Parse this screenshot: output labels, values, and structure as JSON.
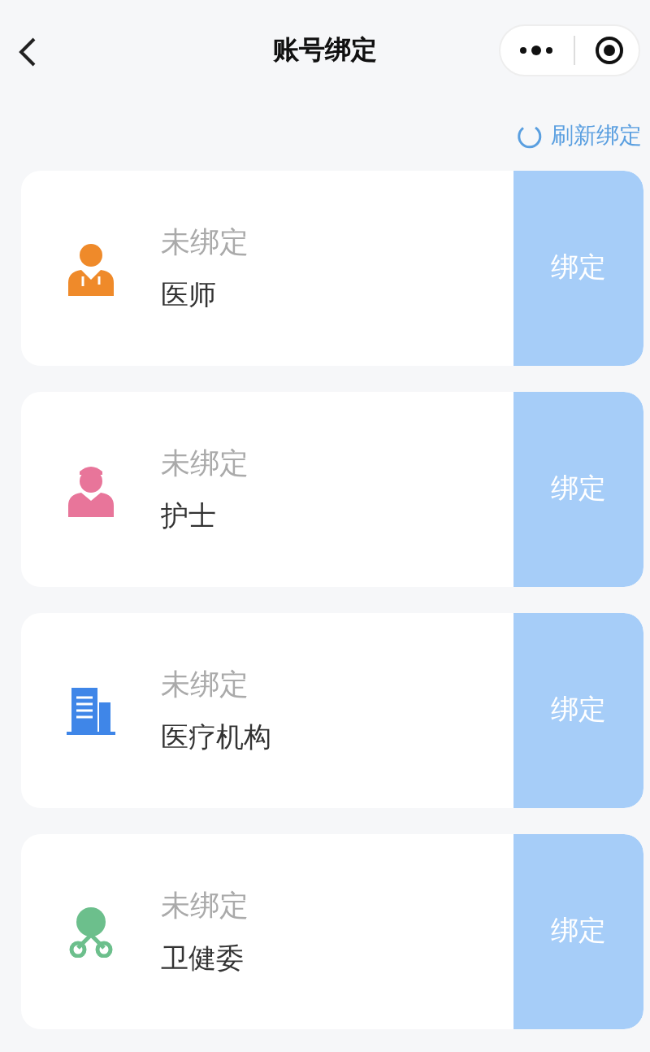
{
  "nav": {
    "title": "账号绑定"
  },
  "refresh": {
    "label": "刷新绑定"
  },
  "accounts": [
    {
      "kind": "doctor",
      "status": "未绑定",
      "role": "医师",
      "button": "绑定"
    },
    {
      "kind": "nurse",
      "status": "未绑定",
      "role": "护士",
      "button": "绑定"
    },
    {
      "kind": "institution",
      "status": "未绑定",
      "role": "医疗机构",
      "button": "绑定"
    },
    {
      "kind": "commission",
      "status": "未绑定",
      "role": "卫健委",
      "button": "绑定"
    }
  ]
}
